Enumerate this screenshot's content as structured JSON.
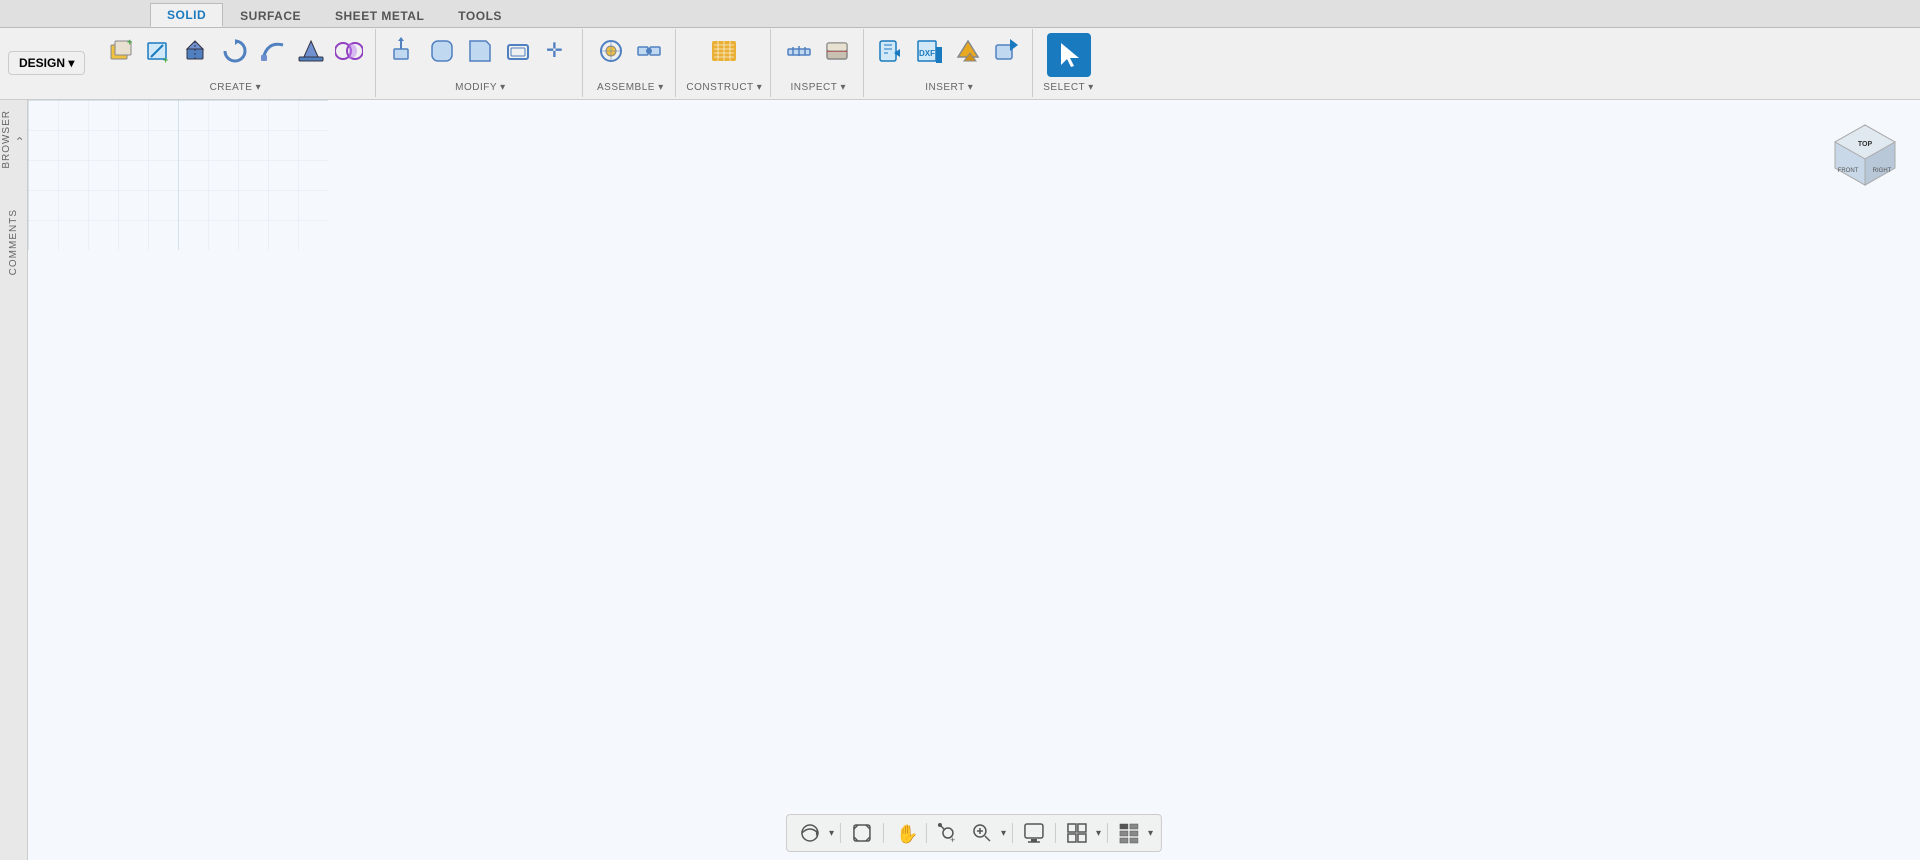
{
  "tabs": [
    {
      "label": "SOLID",
      "active": true
    },
    {
      "label": "SURFACE",
      "active": false
    },
    {
      "label": "SHEET METAL",
      "active": false
    },
    {
      "label": "TOOLS",
      "active": false
    }
  ],
  "design_button": {
    "label": "DESIGN ▾"
  },
  "toolbar_groups": [
    {
      "name": "create",
      "label": "CREATE ▾",
      "icons": [
        "✦",
        "⊞",
        "▣",
        "⌓",
        "◯",
        "⊡",
        "✸"
      ]
    },
    {
      "name": "modify",
      "label": "MODIFY ▾",
      "icons": [
        "◧",
        "◨",
        "▤",
        "▥",
        "✛"
      ]
    },
    {
      "name": "assemble",
      "label": "ASSEMBLE ▾",
      "icons": [
        "⊕",
        "⊗"
      ]
    },
    {
      "name": "construct",
      "label": "CONSTRUCT ▾",
      "icons": [
        "⊞"
      ]
    },
    {
      "name": "inspect",
      "label": "INSPECT ▾",
      "icons": [
        "⊟",
        "⊡"
      ]
    },
    {
      "name": "insert",
      "label": "INSERT ▾",
      "icons": [
        "⊕",
        "DXF",
        "⊞",
        "⊟"
      ]
    },
    {
      "name": "select",
      "label": "SELECT ▾",
      "icons": [
        "↖"
      ]
    }
  ],
  "sidebar": {
    "items": [
      "BROWSER",
      "COMMENTS"
    ]
  },
  "bottom_toolbar": {
    "buttons": [
      "⊕▾",
      "⊡",
      "✋",
      "🔍+",
      "🔍▾",
      "▣",
      "⊞▾",
      "⊟▾"
    ]
  },
  "nav_cube": {
    "faces": [
      "TOP",
      "FRONT",
      "RIGHT"
    ]
  },
  "colors": {
    "accent_blue": "#1a7abf",
    "toolbar_bg": "#f0f0f0",
    "tab_active_color": "#1a7abf",
    "grid_color": "#d0dde8",
    "sketch_color": "#70c8e8",
    "model_face": "#c8c0b0",
    "model_edge": "#888880",
    "axis_red": "rgba(220,80,80,0.5)",
    "axis_green": "rgba(80,180,80,0.5)"
  }
}
